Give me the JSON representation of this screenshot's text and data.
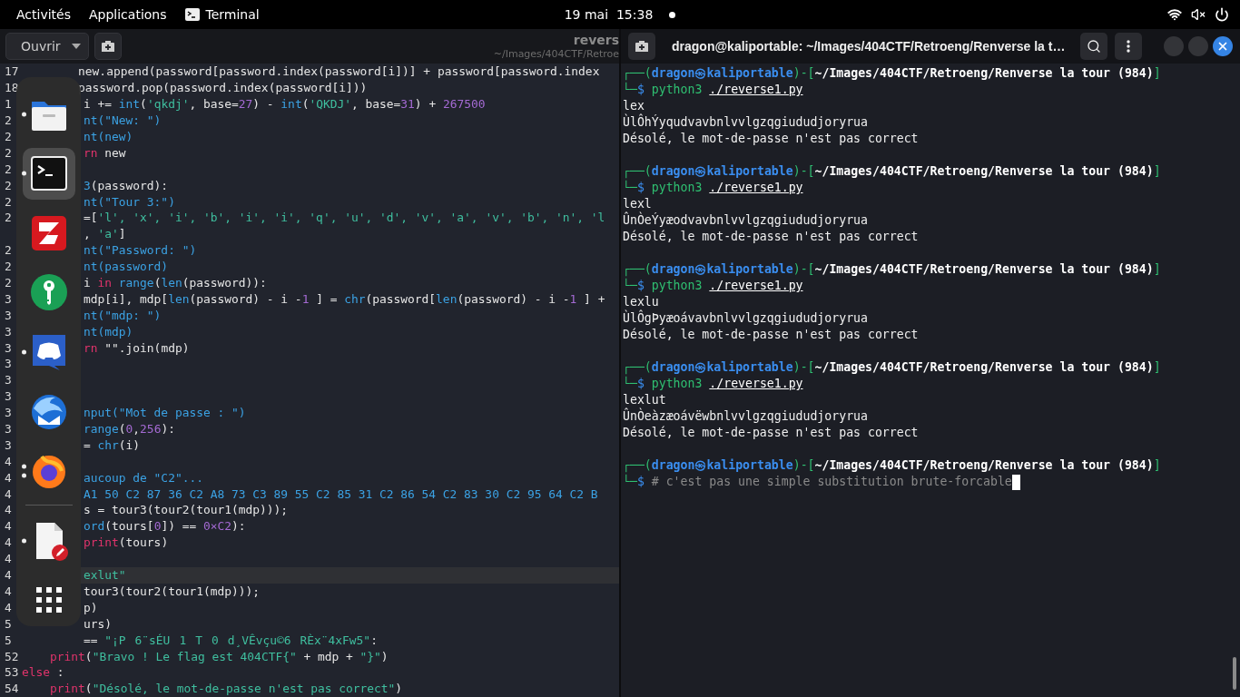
{
  "top_bar": {
    "activities": "Activités",
    "applications": "Applications",
    "app_menu": "Terminal",
    "clock": "19 mai  15:38",
    "notification": true
  },
  "editor": {
    "open_button": "Ouvrir",
    "title": "revers",
    "subtitle": "~/Images/404CTF/Retroe",
    "lines": [
      {
        "number": "17",
        "covered": false,
        "current": false,
        "code": [
          {
            "kind": "plain",
            "text": "        new.append(password[password.index(password[i])] + password[password.index"
          }
        ]
      },
      {
        "number": "18",
        "covered": false,
        "current": false,
        "code": [
          {
            "kind": "plain",
            "text": "        password.pop(password.index(password[i]))"
          }
        ]
      },
      {
        "number": "1",
        "covered": true,
        "current": false,
        "code": [
          {
            "kind": "plain",
            "text": "i += "
          },
          {
            "kind": "builtin",
            "text": "int"
          },
          {
            "kind": "plain",
            "text": "("
          },
          {
            "kind": "string",
            "text": "'qkdj'"
          },
          {
            "kind": "plain",
            "text": ", base="
          },
          {
            "kind": "number",
            "text": "27"
          },
          {
            "kind": "plain",
            "text": ") - "
          },
          {
            "kind": "builtin",
            "text": "int"
          },
          {
            "kind": "plain",
            "text": "("
          },
          {
            "kind": "string",
            "text": "'QKDJ'"
          },
          {
            "kind": "plain",
            "text": ", base="
          },
          {
            "kind": "number",
            "text": "31"
          },
          {
            "kind": "plain",
            "text": ") + "
          },
          {
            "kind": "number",
            "text": "267500"
          }
        ]
      },
      {
        "number": "2",
        "covered": true,
        "current": false,
        "code": [
          {
            "kind": "builtin",
            "text": "nt(\"New: \")"
          }
        ]
      },
      {
        "number": "2",
        "covered": true,
        "current": false,
        "code": [
          {
            "kind": "builtin",
            "text": "nt(new)"
          }
        ]
      },
      {
        "number": "2",
        "covered": true,
        "current": false,
        "code": [
          {
            "kind": "keyword",
            "text": "rn"
          },
          {
            "kind": "plain",
            "text": " new"
          }
        ]
      },
      {
        "number": "2",
        "current": false
      },
      {
        "number": "2",
        "covered": true,
        "current": false,
        "code": [
          {
            "kind": "builtin",
            "text": "3"
          },
          {
            "kind": "plain",
            "text": "(password):"
          }
        ]
      },
      {
        "number": "2",
        "covered": true,
        "current": false,
        "code": [
          {
            "kind": "builtin",
            "text": "nt(\"Tour 3:\")"
          }
        ]
      },
      {
        "number": "2",
        "covered": true,
        "current": false,
        "code": [
          {
            "kind": "plain",
            "text": "=["
          },
          {
            "kind": "string",
            "text": "'l', 'x', 'i', 'b', 'i', 'i', 'q', 'u', 'd', 'v', 'a', 'v', 'b', 'n', 'l"
          }
        ]
      },
      {
        "covered": true,
        "current": false,
        "code": [
          {
            "kind": "plain",
            "text": ", "
          },
          {
            "kind": "string",
            "text": "'a'"
          },
          {
            "kind": "plain",
            "text": "]"
          }
        ]
      },
      {
        "number": "2",
        "covered": true,
        "current": false,
        "code": [
          {
            "kind": "builtin",
            "text": "nt(\"Password: \")"
          }
        ]
      },
      {
        "number": "2",
        "covered": true,
        "current": false,
        "code": [
          {
            "kind": "builtin",
            "text": "nt(password)"
          }
        ]
      },
      {
        "number": "2",
        "covered": true,
        "current": false,
        "code": [
          {
            "kind": "plain",
            "text": "i "
          },
          {
            "kind": "keyword",
            "text": "in "
          },
          {
            "kind": "builtin",
            "text": "range"
          },
          {
            "kind": "plain",
            "text": "("
          },
          {
            "kind": "builtin",
            "text": "len"
          },
          {
            "kind": "plain",
            "text": "(password)):"
          }
        ]
      },
      {
        "number": "3",
        "covered": true,
        "current": false,
        "code": [
          {
            "kind": "plain",
            "text": "mdp[i], mdp["
          },
          {
            "kind": "builtin",
            "text": "len"
          },
          {
            "kind": "plain",
            "text": "(password) - i -"
          },
          {
            "kind": "number",
            "text": "1"
          },
          {
            "kind": "plain",
            "text": " ] = "
          },
          {
            "kind": "builtin",
            "text": "chr"
          },
          {
            "kind": "plain",
            "text": "(password["
          },
          {
            "kind": "builtin",
            "text": "len"
          },
          {
            "kind": "plain",
            "text": "(password) - i -"
          },
          {
            "kind": "number",
            "text": "1"
          },
          {
            "kind": "plain",
            "text": " ] +"
          }
        ]
      },
      {
        "number": "3",
        "covered": true,
        "current": false,
        "code": [
          {
            "kind": "builtin",
            "text": "nt(\"mdp: \")"
          }
        ]
      },
      {
        "number": "3",
        "covered": true,
        "current": false,
        "code": [
          {
            "kind": "builtin",
            "text": "nt(mdp)"
          }
        ]
      },
      {
        "number": "3",
        "covered": true,
        "current": false,
        "code": [
          {
            "kind": "keyword",
            "text": "rn"
          },
          {
            "kind": "plain",
            "text": " \"\".join(mdp)"
          }
        ]
      },
      {
        "number": "3",
        "current": false
      },
      {
        "number": "3",
        "current": false
      },
      {
        "number": "3",
        "current": false
      },
      {
        "number": "3",
        "covered": true,
        "current": false,
        "code": [
          {
            "kind": "builtin",
            "text": "nput(\"Mot de passe : \")"
          }
        ]
      },
      {
        "number": "3",
        "covered": true,
        "current": false,
        "code": [
          {
            "kind": "builtin",
            "text": "range"
          },
          {
            "kind": "plain",
            "text": "("
          },
          {
            "kind": "number",
            "text": "0"
          },
          {
            "kind": "plain",
            "text": ","
          },
          {
            "kind": "number",
            "text": "256"
          },
          {
            "kind": "plain",
            "text": "):"
          }
        ]
      },
      {
        "number": "3",
        "covered": true,
        "current": false,
        "code": [
          {
            "kind": "plain",
            "text": "= "
          },
          {
            "kind": "builtin",
            "text": "chr"
          },
          {
            "kind": "plain",
            "text": "(i)"
          }
        ]
      },
      {
        "number": "4",
        "current": false
      },
      {
        "number": "4",
        "covered": true,
        "current": false,
        "code": [
          {
            "kind": "builtin",
            "text": "aucoup de \"C2\"..."
          }
        ]
      },
      {
        "number": "4",
        "covered": true,
        "current": false,
        "code": [
          {
            "kind": "builtin",
            "text": "A1 50 C2 87 36 C2 A8 73 C3 89 55 C2 85 31 C2 86 54 C2 83 30 C2 95 64 C2 B"
          }
        ]
      },
      {
        "number": "4",
        "covered": true,
        "current": false,
        "code": [
          {
            "kind": "plain",
            "text": "s = tour3(tour2(tour1(mdp)));"
          }
        ]
      },
      {
        "number": "4",
        "covered": true,
        "current": false,
        "code": [
          {
            "kind": "builtin",
            "text": "ord"
          },
          {
            "kind": "plain",
            "text": "(tours["
          },
          {
            "kind": "number",
            "text": "0"
          },
          {
            "kind": "plain",
            "text": "]) == "
          },
          {
            "kind": "number",
            "text": "0×C2"
          },
          {
            "kind": "plain",
            "text": "):"
          }
        ]
      },
      {
        "number": "4",
        "covered": true,
        "current": false,
        "code": [
          {
            "kind": "keyword",
            "text": "print"
          },
          {
            "kind": "plain",
            "text": "(tours)"
          }
        ]
      },
      {
        "number": "4",
        "current": false
      },
      {
        "number": "4",
        "covered": true,
        "current": true,
        "code": [
          {
            "kind": "string",
            "text": "exlut\""
          }
        ]
      },
      {
        "number": "4",
        "covered": true,
        "current": false,
        "code": [
          {
            "kind": "plain",
            "text": "tour3(tour2(tour1(mdp)));"
          }
        ]
      },
      {
        "number": "4",
        "covered": true,
        "current": false,
        "code": [
          {
            "kind": "plain",
            "text": "p)"
          }
        ]
      },
      {
        "number": "5",
        "covered": true,
        "current": false,
        "code": [
          {
            "kind": "plain",
            "text": "urs)"
          }
        ]
      },
      {
        "number": "5",
        "covered": true,
        "current": false,
        "code": [
          {
            "kind": "plain",
            "text": "== "
          },
          {
            "kind": "string",
            "text": "\"¡P6¨sÉU1T0d¸VÊvçu©6RÈx¨4xFw5\""
          },
          {
            "kind": "plain",
            "text": ":"
          }
        ]
      },
      {
        "number": "52",
        "covered": false,
        "current": false,
        "code": [
          {
            "kind": "keyword",
            "text": "    print"
          },
          {
            "kind": "plain",
            "text": "("
          },
          {
            "kind": "string",
            "text": "\"Bravo ! Le flag est 404CTF{\""
          },
          {
            "kind": "plain",
            "text": " + mdp + "
          },
          {
            "kind": "string",
            "text": "\"}\""
          },
          {
            "kind": "plain",
            "text": ")"
          }
        ]
      },
      {
        "number": "53",
        "covered": false,
        "current": false,
        "code": [
          {
            "kind": "keyword",
            "text": "else"
          },
          {
            "kind": "plain",
            "text": " :"
          }
        ]
      },
      {
        "number": "54",
        "covered": false,
        "current": false,
        "code": [
          {
            "kind": "keyword",
            "text": "    print"
          },
          {
            "kind": "plain",
            "text": "("
          },
          {
            "kind": "string",
            "text": "\"Désolé, le mot-de-passe n'est pas correct\""
          },
          {
            "kind": "plain",
            "text": ")"
          }
        ]
      }
    ]
  },
  "dock": {
    "items": [
      {
        "kind": "files",
        "running": true,
        "selected": false
      },
      {
        "kind": "terminal",
        "running": true,
        "selected": true
      },
      {
        "kind": "filezilla",
        "running": false,
        "selected": false
      },
      {
        "kind": "keepass",
        "running": false,
        "selected": false
      },
      {
        "kind": "discord",
        "running": true,
        "selected": false
      },
      {
        "kind": "thunderbird",
        "running": false,
        "selected": false
      },
      {
        "kind": "firefox",
        "running": true,
        "multiple": true,
        "selected": false
      },
      {
        "kind": "separator"
      },
      {
        "kind": "text-editor",
        "running": true,
        "selected": false
      },
      {
        "kind": "app-grid",
        "running": false,
        "selected": false
      }
    ]
  },
  "terminal": {
    "title": "dragon@kaliportable: ~/Images/404CTF/Retroeng/Renverse la t…",
    "blocks": [
      {
        "prompt": {
          "open": "┌──(",
          "user": "dragon㉿kaliportable",
          "sep": ")-[",
          "path": "~/Images/404CTF/Retroeng/Renverse la tour (984)",
          "close": "]"
        },
        "lead": "└─",
        "sigil": "$",
        "kind": "run",
        "program": "python3",
        "argument": "./reverse1.py",
        "output": [
          "lex",
          "ÙlÔhÝyqudvavbnlvvlgzqgiududjoryrua",
          "Désolé, le mot-de-passe n'est pas correct"
        ]
      },
      {
        "prompt": {
          "open": "┌──(",
          "user": "dragon㉿kaliportable",
          "sep": ")-[",
          "path": "~/Images/404CTF/Retroeng/Renverse la tour (984)",
          "close": "]"
        },
        "lead": "└─",
        "sigil": "$",
        "kind": "run",
        "program": "python3",
        "argument": "./reverse1.py",
        "output": [
          "lexl",
          "ÛnÒeÝyæodvavbnlvvlgzqgiududjoryrua",
          "Désolé, le mot-de-passe n'est pas correct"
        ]
      },
      {
        "prompt": {
          "open": "┌──(",
          "user": "dragon㉿kaliportable",
          "sep": ")-[",
          "path": "~/Images/404CTF/Retroeng/Renverse la tour (984)",
          "close": "]"
        },
        "lead": "└─",
        "sigil": "$",
        "kind": "run",
        "program": "python3",
        "argument": "./reverse1.py",
        "output": [
          "lexlu",
          "ÙlÔgÞyæoávavbnlvvlgzqgiududjoryrua",
          "Désolé, le mot-de-passe n'est pas correct"
        ]
      },
      {
        "prompt": {
          "open": "┌──(",
          "user": "dragon㉿kaliportable",
          "sep": ")-[",
          "path": "~/Images/404CTF/Retroeng/Renverse la tour (984)",
          "close": "]"
        },
        "lead": "└─",
        "sigil": "$",
        "kind": "run",
        "program": "python3",
        "argument": "./reverse1.py",
        "output": [
          "lexlut",
          "ÛnÒeàzæoávëwbnlvvlgzqgiududjoryrua",
          "Désolé, le mot-de-passe n'est pas correct"
        ]
      },
      {
        "prompt": {
          "open": "┌──(",
          "user": "dragon㉿kaliportable",
          "sep": ")-[",
          "path": "~/Images/404CTF/Retroeng/Renverse la tour (984)",
          "close": "]"
        },
        "lead": "└─",
        "sigil": "$",
        "kind": "comment",
        "text": "# c'est pas une simple substitution brute-forcable",
        "cursor": true
      }
    ]
  }
}
